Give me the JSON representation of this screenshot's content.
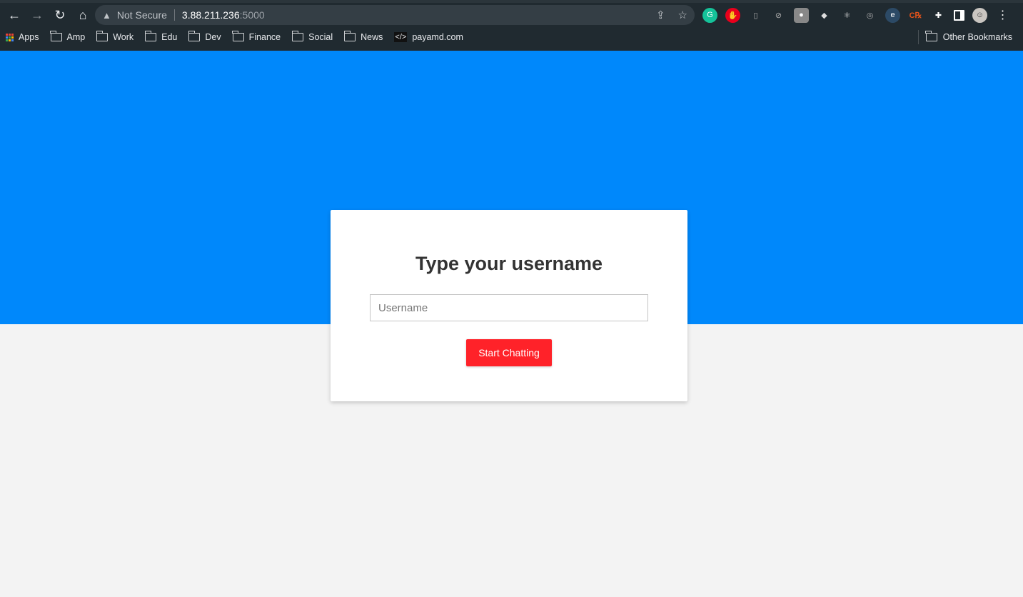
{
  "browser": {
    "security_label": "Not Secure",
    "url_host": "3.88.211.236",
    "url_port": ":5000",
    "bookmarks": [
      "Apps",
      "Amp",
      "Work",
      "Edu",
      "Dev",
      "Finance",
      "Social",
      "News",
      "payamd.com"
    ],
    "other_bookmarks": "Other Bookmarks",
    "extensions": [
      "grammarly",
      "adblock",
      "office",
      "no-script",
      "bulb",
      "tag",
      "react-devtools",
      "screen-capture",
      "e-extension",
      "css-extension"
    ]
  },
  "page": {
    "heading": "Type your username",
    "username_placeholder": "Username",
    "username_value": "",
    "submit_label": "Start Chatting"
  },
  "colors": {
    "hero": "#0088fb",
    "button": "#ff2229",
    "background": "#f3f3f3"
  }
}
